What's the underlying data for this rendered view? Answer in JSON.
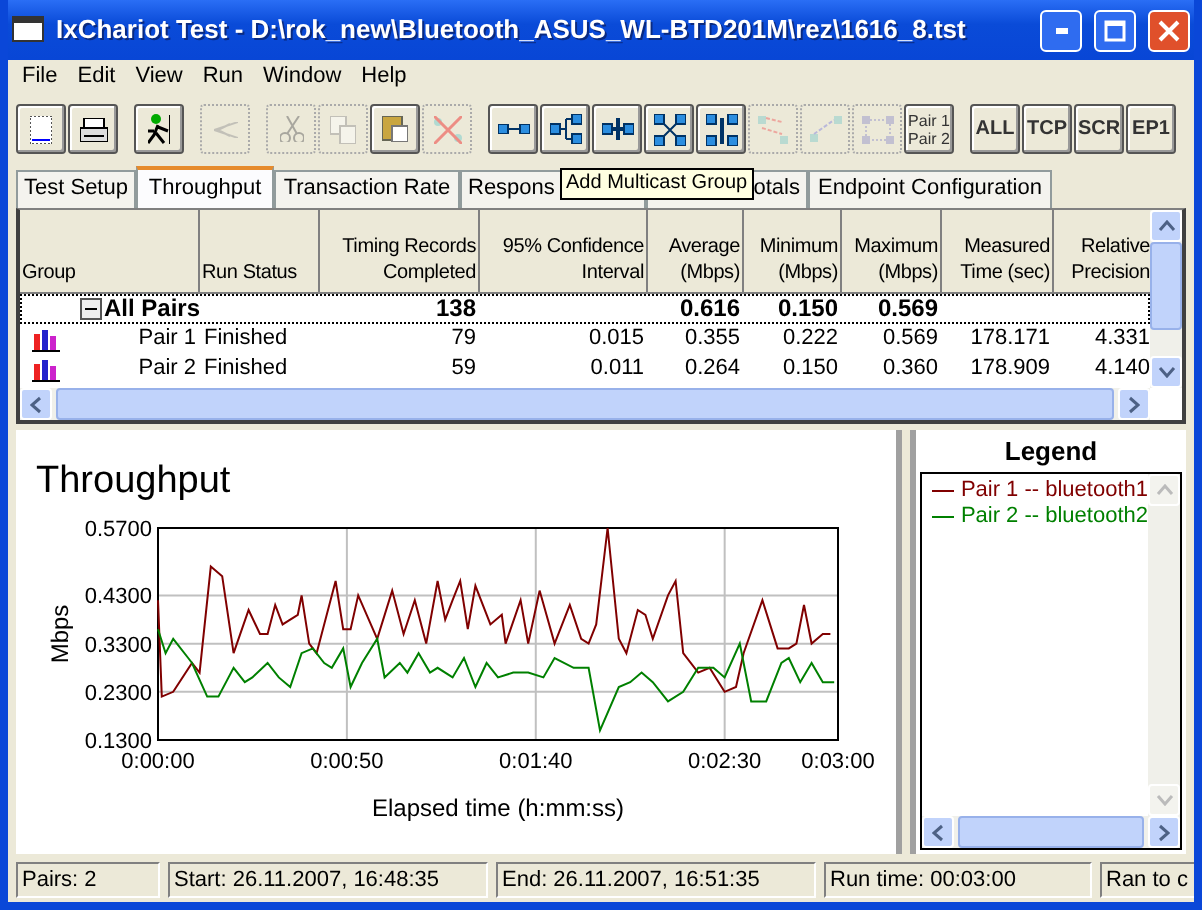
{
  "window": {
    "title": "IxChariot Test - D:\\rok_new\\Bluetooth_ASUS_WL-BTD201M\\rez\\1616_8.tst"
  },
  "menu": [
    "File",
    "Edit",
    "View",
    "Run",
    "Window",
    "Help"
  ],
  "toolbar": [
    {
      "items": [
        {
          "kind": "icon",
          "disabled": false
        },
        {
          "kind": "icon",
          "disabled": false
        }
      ]
    },
    {
      "items": [
        {
          "kind": "icon",
          "disabled": false
        }
      ]
    },
    {
      "items": [
        {
          "kind": "icon",
          "disabled": true
        }
      ]
    },
    {
      "items": [
        {
          "kind": "icon",
          "disabled": true
        },
        {
          "kind": "icon",
          "disabled": true
        },
        {
          "kind": "icon",
          "disabled": false
        },
        {
          "kind": "icon",
          "disabled": true
        }
      ]
    },
    {
      "items": [
        {
          "kind": "icon",
          "disabled": false
        },
        {
          "kind": "icon",
          "disabled": false
        },
        {
          "kind": "icon",
          "disabled": false
        },
        {
          "kind": "icon",
          "disabled": false
        },
        {
          "kind": "icon",
          "disabled": false
        },
        {
          "kind": "icon",
          "disabled": true
        },
        {
          "kind": "icon",
          "disabled": true
        },
        {
          "kind": "icon",
          "disabled": true
        },
        {
          "kind": "text",
          "label": "Pair 1 Pair 2",
          "disabled": false
        }
      ]
    },
    {
      "items": [
        {
          "kind": "text",
          "label": "ALL",
          "disabled": false
        },
        {
          "kind": "text",
          "label": "TCP",
          "disabled": false
        },
        {
          "kind": "text",
          "label": "SCR",
          "disabled": false
        },
        {
          "kind": "text",
          "label": "EP1",
          "disabled": false
        }
      ]
    }
  ],
  "tabs": [
    {
      "label": "Test Setup",
      "selected": false
    },
    {
      "label": "Throughput",
      "selected": true
    },
    {
      "label": "Transaction Rate",
      "selected": false
    },
    {
      "label": "Respons",
      "selected": false
    },
    {
      "label": "otals",
      "selected": false
    },
    {
      "label": "Endpoint Configuration",
      "selected": false
    }
  ],
  "tooltip": "Add Multicast Group",
  "table": {
    "columns": [
      "Group",
      "Run Status",
      "Timing Records Completed",
      "95% Confidence Interval",
      "Average (Mbps)",
      "Minimum (Mbps)",
      "Maximum (Mbps)",
      "Measured Time (sec)",
      "Relative Precision"
    ],
    "rows": [
      {
        "kind": "group",
        "expanded": true,
        "focused": true,
        "cells": [
          "All Pairs",
          null,
          "138",
          null,
          "0.616",
          "0.150",
          "0.569",
          null,
          null
        ]
      },
      {
        "kind": "pair",
        "focused": false,
        "cells": [
          "Pair 1",
          "Finished",
          "79",
          "0.015",
          "0.355",
          "0.222",
          "0.569",
          "178.171",
          "4.331"
        ]
      },
      {
        "kind": "pair",
        "focused": false,
        "cells": [
          "Pair 2",
          "Finished",
          "59",
          "0.011",
          "0.264",
          "0.150",
          "0.360",
          "178.909",
          "4.140"
        ]
      }
    ]
  },
  "chart": {
    "chart_data": {
      "type": "line",
      "grid": true,
      "title": "Throughput",
      "xlabel": "Elapsed time (h:mm:ss)",
      "ylabel": "Mbps",
      "xlim": [
        0,
        180
      ],
      "ylim": [
        0.13,
        0.57
      ],
      "xticks": [
        {
          "value": 0,
          "label": "0:00:00"
        },
        {
          "value": 50,
          "label": "0:00:50"
        },
        {
          "value": 100,
          "label": "0:01:40"
        },
        {
          "value": 150,
          "label": "0:02:30"
        },
        {
          "value": 180,
          "label": "0:03:00"
        }
      ],
      "yticks": [
        {
          "value": 0.13,
          "label": "0.1300"
        },
        {
          "value": 0.23,
          "label": "0.2300"
        },
        {
          "value": 0.33,
          "label": "0.3300"
        },
        {
          "value": 0.43,
          "label": "0.4300"
        },
        {
          "value": 0.57,
          "label": "0.5700"
        }
      ],
      "series": [
        {
          "color": "#800000",
          "x": [
            0,
            1,
            4,
            9,
            11,
            14,
            17,
            20,
            24,
            27,
            29,
            31,
            33,
            37,
            38,
            40,
            42,
            47,
            49,
            51,
            53,
            58,
            62,
            65,
            68,
            71,
            74,
            76,
            78,
            80,
            82,
            84,
            88,
            91,
            92,
            96,
            98,
            101,
            105,
            109,
            112,
            114,
            116,
            119,
            122,
            124,
            127,
            129,
            131,
            135,
            137,
            139,
            143,
            146,
            150,
            153,
            155,
            160,
            164,
            167,
            169,
            171,
            173,
            176,
            178
          ],
          "values": [
            0.42,
            0.22,
            0.23,
            0.29,
            0.27,
            0.49,
            0.47,
            0.31,
            0.4,
            0.35,
            0.35,
            0.41,
            0.37,
            0.39,
            0.43,
            0.33,
            0.31,
            0.46,
            0.36,
            0.36,
            0.43,
            0.34,
            0.44,
            0.35,
            0.42,
            0.33,
            0.46,
            0.38,
            0.42,
            0.46,
            0.36,
            0.45,
            0.37,
            0.39,
            0.33,
            0.42,
            0.33,
            0.44,
            0.33,
            0.41,
            0.34,
            0.33,
            0.37,
            0.57,
            0.34,
            0.31,
            0.4,
            0.39,
            0.34,
            0.43,
            0.46,
            0.31,
            0.27,
            0.28,
            0.23,
            0.24,
            0.31,
            0.42,
            0.32,
            0.32,
            0.33,
            0.41,
            0.33,
            0.35,
            0.35
          ]
        },
        {
          "color": "#008000",
          "x": [
            0,
            2,
            4,
            8,
            9,
            13,
            16,
            20,
            23,
            25,
            29,
            32,
            35,
            38,
            41,
            44,
            46,
            49,
            51,
            54,
            58,
            60,
            64,
            66,
            69,
            72,
            74,
            78,
            81,
            84,
            87,
            90,
            94,
            98,
            102,
            105,
            110,
            114,
            117,
            122,
            125,
            128,
            131,
            135,
            139,
            143,
            147,
            150,
            154,
            157,
            161,
            165,
            167,
            170,
            173,
            176,
            179
          ],
          "values": [
            0.36,
            0.31,
            0.34,
            0.3,
            0.29,
            0.22,
            0.22,
            0.28,
            0.25,
            0.26,
            0.29,
            0.26,
            0.24,
            0.31,
            0.32,
            0.29,
            0.28,
            0.32,
            0.24,
            0.29,
            0.34,
            0.26,
            0.29,
            0.27,
            0.31,
            0.27,
            0.28,
            0.26,
            0.3,
            0.24,
            0.29,
            0.26,
            0.27,
            0.27,
            0.26,
            0.3,
            0.28,
            0.28,
            0.15,
            0.24,
            0.25,
            0.27,
            0.25,
            0.21,
            0.23,
            0.28,
            0.28,
            0.26,
            0.33,
            0.21,
            0.21,
            0.29,
            0.3,
            0.25,
            0.29,
            0.25,
            0.25
          ]
        }
      ]
    }
  },
  "legend": {
    "title": "Legend",
    "items": [
      {
        "label": "Pair 1 -- bluetooth1",
        "color": "#800000"
      },
      {
        "label": "Pair 2 -- bluetooth2",
        "color": "#008000"
      }
    ]
  },
  "status_bar": [
    "Pairs: 2",
    "Start: 26.11.2007, 16:48:35",
    "End: 26.11.2007, 16:51:35",
    "Run time: 00:03:00",
    "Ran to c"
  ]
}
